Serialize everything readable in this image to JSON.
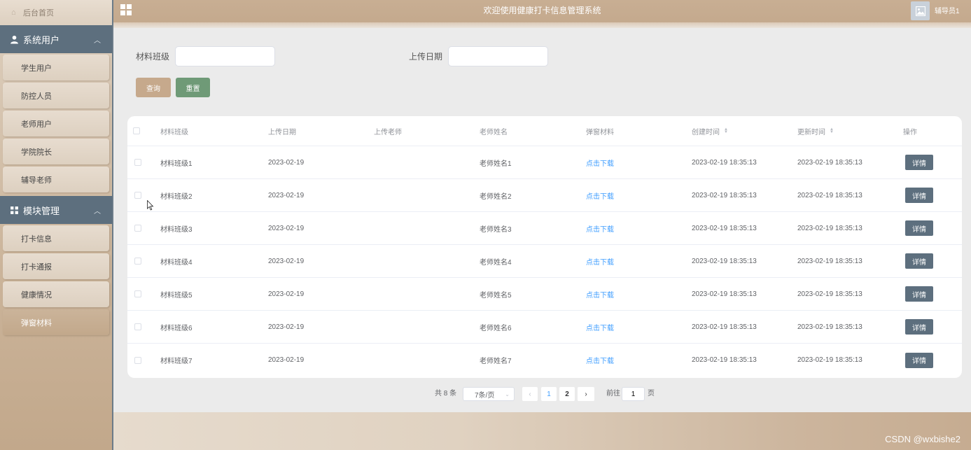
{
  "sidebar": {
    "home_label": "后台首页",
    "groups": [
      {
        "label": "系统用户",
        "items": [
          "学生用户",
          "防控人员",
          "老师用户",
          "学院院长",
          "辅导老师"
        ]
      },
      {
        "label": "模块管理",
        "items": [
          "打卡信息",
          "打卡通报",
          "健康情况",
          "弹窗材料"
        ]
      }
    ],
    "active_item": "弹窗材料"
  },
  "header": {
    "title": "欢迎使用健康打卡信息管理系统",
    "username": "辅导员1"
  },
  "search": {
    "class_label": "材料班级",
    "class_value": "",
    "date_label": "上传日期",
    "date_value": "",
    "query_button": "查询",
    "reset_button": "重置"
  },
  "table": {
    "columns": [
      "材料班级",
      "上传日期",
      "上传老师",
      "老师姓名",
      "弹窗材料",
      "创建时间",
      "更新时间",
      "操作"
    ],
    "rows": [
      {
        "class": "材料班级1",
        "date": "2023-02-19",
        "teacher": "",
        "teacher_name": "老师姓名1",
        "material": "点击下载",
        "created": "2023-02-19 18:35:13",
        "updated": "2023-02-19 18:35:13",
        "action": "详情"
      },
      {
        "class": "材料班级2",
        "date": "2023-02-19",
        "teacher": "",
        "teacher_name": "老师姓名2",
        "material": "点击下载",
        "created": "2023-02-19 18:35:13",
        "updated": "2023-02-19 18:35:13",
        "action": "详情"
      },
      {
        "class": "材料班级3",
        "date": "2023-02-19",
        "teacher": "",
        "teacher_name": "老师姓名3",
        "material": "点击下载",
        "created": "2023-02-19 18:35:13",
        "updated": "2023-02-19 18:35:13",
        "action": "详情"
      },
      {
        "class": "材料班级4",
        "date": "2023-02-19",
        "teacher": "",
        "teacher_name": "老师姓名4",
        "material": "点击下载",
        "created": "2023-02-19 18:35:13",
        "updated": "2023-02-19 18:35:13",
        "action": "详情"
      },
      {
        "class": "材料班级5",
        "date": "2023-02-19",
        "teacher": "",
        "teacher_name": "老师姓名5",
        "material": "点击下载",
        "created": "2023-02-19 18:35:13",
        "updated": "2023-02-19 18:35:13",
        "action": "详情"
      },
      {
        "class": "材料班级6",
        "date": "2023-02-19",
        "teacher": "",
        "teacher_name": "老师姓名6",
        "material": "点击下载",
        "created": "2023-02-19 18:35:13",
        "updated": "2023-02-19 18:35:13",
        "action": "详情"
      },
      {
        "class": "材料班级7",
        "date": "2023-02-19",
        "teacher": "",
        "teacher_name": "老师姓名7",
        "material": "点击下载",
        "created": "2023-02-19 18:35:13",
        "updated": "2023-02-19 18:35:13",
        "action": "详情"
      }
    ]
  },
  "pagination": {
    "total_text": "共 8 条",
    "page_size": "7条/页",
    "pages": [
      "1",
      "2"
    ],
    "current_page": "1",
    "goto_label": "前往",
    "goto_value": "1",
    "page_suffix": "页"
  },
  "colors": {
    "accent_tan": "#c6a98c",
    "sidebar_group": "#5d6f7e",
    "reset_green": "#6f9a77",
    "link_blue": "#409eff"
  },
  "watermark": "CSDN @wxbishe2"
}
